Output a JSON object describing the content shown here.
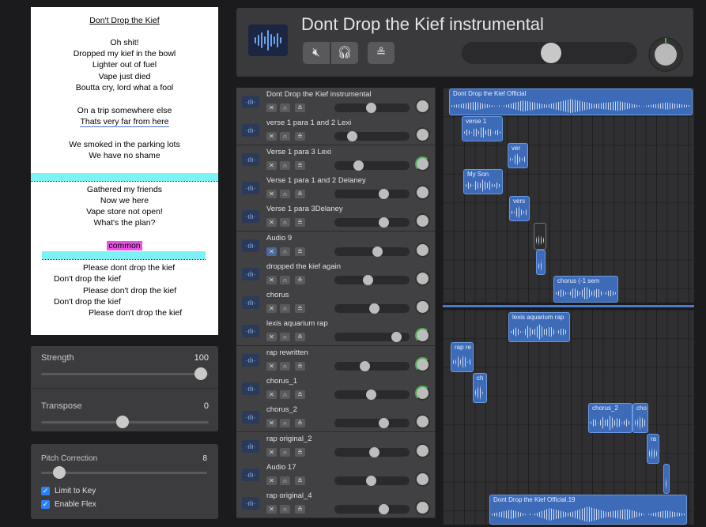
{
  "lyrics": {
    "title": "Don't Drop the Kief",
    "lines": [
      "Oh shit!",
      "Dropped my kief in the bowl",
      "Lighter out of fuel",
      "Vape just died",
      "Boutta cry, lord what a fool",
      "On a trip somewhere else",
      "Thats very far from here",
      "We smoked in the parking lots",
      "We have no shame",
      "Gathered my friends",
      "Now we here",
      "Vape store not open!",
      "What's the plan?",
      "common",
      "Please dont drop the kief",
      "Don't drop the kief",
      "Please don't drop the kief",
      "Don't drop the kief",
      "Please don't drop the kief"
    ]
  },
  "strength": {
    "label": "Strength",
    "value": "100"
  },
  "transpose": {
    "label": "Transpose",
    "value": "0"
  },
  "pitch": {
    "label": "Pitch Correction",
    "value": "8",
    "limit_to_key": "Limit to Key",
    "enable_flex": "Enable Flex"
  },
  "header": {
    "title": "Dont Drop the Kief instrumental"
  },
  "tracks": [
    {
      "name": "Dont Drop the Kief instrumental",
      "vol": 0.5
    },
    {
      "name": "verse 1 para 1 and 2 Lexi",
      "vol": 0.2
    },
    {
      "name": "Verse 1 para 3 Lexi",
      "vol": 0.3
    },
    {
      "name": "Verse 1 para 1 and 2 Delaney",
      "vol": 0.7
    },
    {
      "name": "Verse 1 para 3Delaney",
      "vol": 0.7
    },
    {
      "name": "Audio 9",
      "vol": 0.6
    },
    {
      "name": "dropped the kief again",
      "vol": 0.45
    },
    {
      "name": "chorus",
      "vol": 0.55
    },
    {
      "name": "lexis aquarium rap",
      "vol": 0.9
    },
    {
      "name": "rap rewritten",
      "vol": 0.4
    },
    {
      "name": "chorus_1",
      "vol": 0.5
    },
    {
      "name": "chorus_2",
      "vol": 0.7
    },
    {
      "name": "rap original_2",
      "vol": 0.55
    },
    {
      "name": "Audio 17",
      "vol": 0.5
    },
    {
      "name": "rap original_4",
      "vol": 0.7
    }
  ],
  "clips": {
    "official": "Dont Drop the Kief Official",
    "official_badge": "②",
    "verse1": "verse 1",
    "ver": "ver",
    "my_son": "My Son",
    "vers": "vers",
    "chorus": "chorus (-1 sem",
    "lexis": "lexis aquarium rap",
    "rap_re": "rap re",
    "ch": "ch",
    "chorus_2": "chorus_2",
    "cho": "cho",
    "ra": "ra",
    "official19": "Dont Drop the Kief Official.19",
    "official19_badge": "③"
  },
  "icons": {
    "mute": "speaker-mute-icon",
    "headphones": "headphones-icon",
    "record": "input-monitor-icon",
    "waveform": "waveform-icon"
  }
}
